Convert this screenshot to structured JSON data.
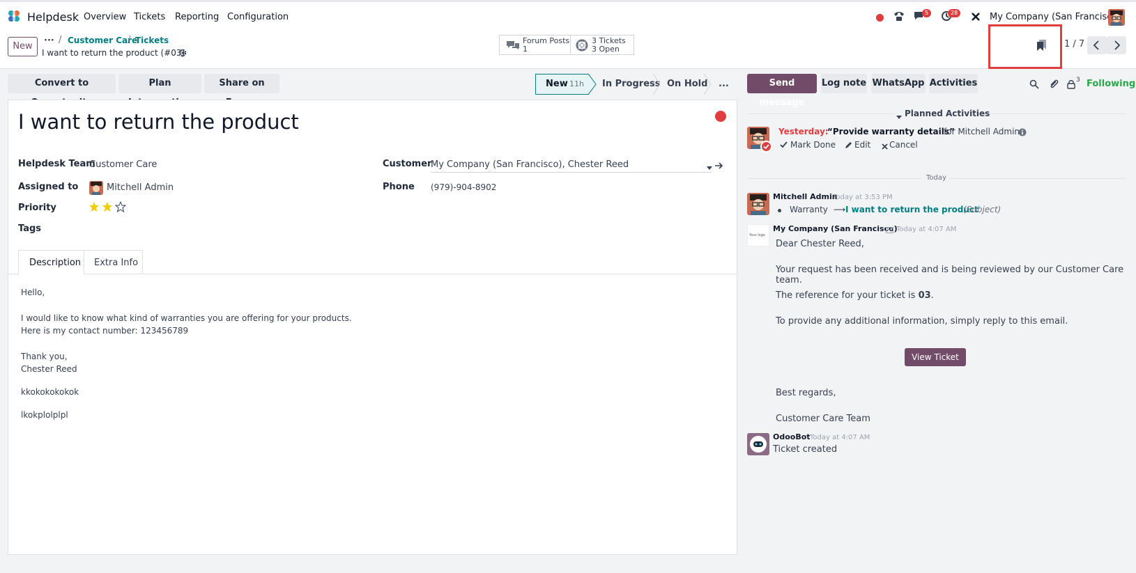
{
  "app": {
    "name": "Helpdesk",
    "menu": [
      "Overview",
      "Tickets",
      "Reporting",
      "Configuration"
    ]
  },
  "systray": {
    "messages_count": "5",
    "activities_count": "28",
    "company": "My Company (San Francisco)"
  },
  "breadcrumb": {
    "ellipsis": "···",
    "items": [
      "Customer Care",
      "Tickets"
    ],
    "current": "I want to return the product (#03)"
  },
  "buttons": {
    "new": "New"
  },
  "smart_buttons": {
    "forum_label": "Forum Posts",
    "forum_count": "1",
    "tickets_label": "3 Tickets",
    "tickets_open": "3 Open"
  },
  "pager": {
    "value": "1 / 7"
  },
  "actions": [
    "Convert to Opportunity",
    "Plan Intervention",
    "Share on Forum"
  ],
  "stages": {
    "new": "New",
    "new_time": "11h",
    "in_progress": "In Progress",
    "on_hold": "On Hold",
    "more": "..."
  },
  "ticket": {
    "title": "I want to return the product",
    "fields": {
      "team_label": "Helpdesk Team",
      "team": "Customer Care",
      "assigned_label": "Assigned to",
      "assigned": "Mitchell Admin",
      "priority_label": "Priority",
      "priority_stars": 2,
      "tags_label": "Tags",
      "customer_label": "Customer",
      "customer": "My Company (San Francisco), Chester Reed",
      "phone_label": "Phone",
      "phone": "(979)-904-8902"
    },
    "tabs": [
      "Description",
      "Extra Info"
    ],
    "description": [
      "Hello,",
      "I would like to know what kind of warranties you are offering for your products.",
      "Here is my contact number: 123456789",
      "Thank you,",
      "Chester Reed",
      "kkokokokokok",
      "lkokplolplpl"
    ]
  },
  "chatter": {
    "buttons": {
      "send": "Send message",
      "log": "Log note",
      "whatsapp": "WhatsApp",
      "activities": "Activities",
      "follower_count": "3",
      "following": "Following"
    },
    "planned_header": "Planned Activities",
    "activity": {
      "when": "Yesterday:",
      "title": "“Provide warranty details”",
      "for": "for Mitchell Admin",
      "mark_done": "Mark Done",
      "edit": "Edit",
      "cancel": "Cancel"
    },
    "today": "Today",
    "messages": [
      {
        "author": "Mitchell Admin",
        "time": "Today at 3:53 PM",
        "field": "Warranty",
        "arrow": "⟶",
        "new_value": "I want to return the product",
        "field_name": "(Subject)"
      },
      {
        "author": "My Company (San Francisco)",
        "time": "Today at 4:07 AM",
        "logo_text": "Your logo",
        "lines": [
          "Dear Chester Reed,",
          "Your request has been received and is being reviewed by our Customer Care team.",
          "The reference for your ticket is ",
          "To provide any additional information, simply reply to this email."
        ],
        "ref": "03",
        "ref_end": ".",
        "button": "View Ticket",
        "closing": [
          "Best regards,",
          "Customer Care Team"
        ]
      },
      {
        "author": "OdooBot",
        "time": "Today at 4:07 AM",
        "body": "Ticket created"
      }
    ]
  },
  "colors": {
    "primary": "#714b67",
    "link": "#017e84",
    "danger": "#e03e3e",
    "highlight": "#e03e3e",
    "star": "#f3cc00",
    "following": "#28a745"
  }
}
